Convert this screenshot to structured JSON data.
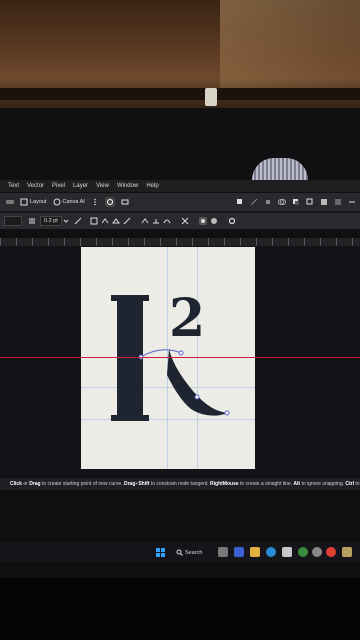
{
  "menu": [
    "Text",
    "Vector",
    "Pixel",
    "Layer",
    "View",
    "Window",
    "Help"
  ],
  "toolbar": {
    "layout_label": "Layout",
    "canva_ai_label": "Canva AI"
  },
  "context_toolbar": {
    "stroke_width": "0.2 pt"
  },
  "status_bar": {
    "text_parts": [
      {
        "t": "Click",
        "b": true
      },
      {
        "t": " or ",
        "b": false
      },
      {
        "t": "Drag",
        "b": true
      },
      {
        "t": " to create starting point of new curve. ",
        "b": false
      },
      {
        "t": "Drag",
        "b": true
      },
      {
        "t": "+",
        "b": false
      },
      {
        "t": "Shift",
        "b": true
      },
      {
        "t": " to constrain node tangent. ",
        "b": false
      },
      {
        "t": "RightMouse",
        "b": true
      },
      {
        "t": " to create a straight line. ",
        "b": false
      },
      {
        "t": "Alt",
        "b": true
      },
      {
        "t": " to ignore snapping. ",
        "b": false
      },
      {
        "t": "Ctrl",
        "b": true
      },
      {
        "t": " to sna",
        "b": false
      }
    ]
  },
  "artboard": {
    "superscript": "2",
    "glyph_color": "#1e2430"
  },
  "taskbar": {
    "search_label": "Search"
  },
  "colors": {
    "guide": "#c8203c",
    "grid": "#9fbfe0",
    "artboard_bg": "#ecebe6"
  }
}
